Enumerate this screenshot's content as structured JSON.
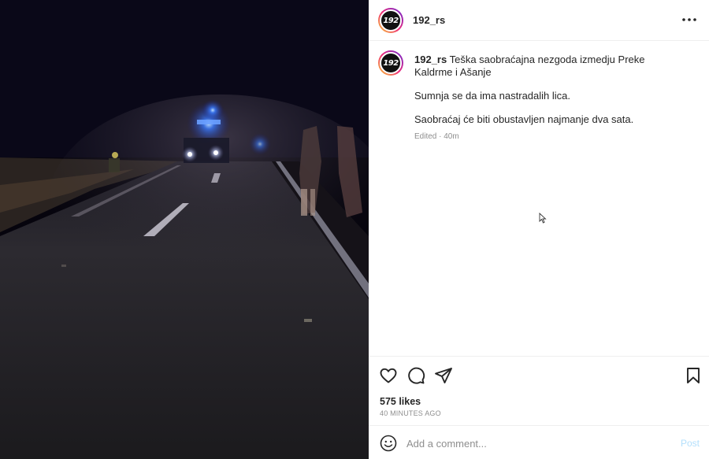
{
  "post": {
    "username": "192_rs",
    "avatar_text": "192",
    "caption": {
      "username": "192_rs",
      "text": "Teška saobraćajna nezgoda izmedju Preke Kaldrme i Ašanje",
      "line2": "Sumnja se da ima nastradalih lica.",
      "line3": "Saobraćaj će biti obustavljen najmanje dva sata.",
      "edited": "Edited · 40m"
    },
    "likes": "575 likes",
    "time_ago": "40 MINUTES AGO",
    "comment": {
      "placeholder": "Add a comment...",
      "post_label": "Post"
    }
  },
  "icons": {
    "more": "more-horizontal-icon",
    "like": "heart-icon",
    "comment": "comment-icon",
    "share": "share-icon",
    "save": "bookmark-icon",
    "emoji": "emoji-icon"
  },
  "colors": {
    "link_disabled": "#b2dffc",
    "meta_gray": "#8e8e8e",
    "text": "#262626"
  }
}
